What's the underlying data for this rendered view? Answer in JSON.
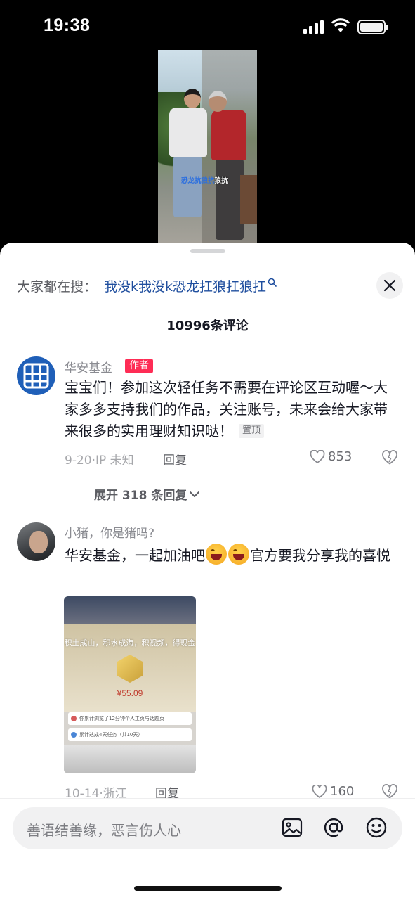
{
  "status_bar": {
    "time": "19:38"
  },
  "video": {
    "caption_blue": "恐龙抗狼抗",
    "caption_white": "狼抗"
  },
  "search": {
    "prefix": "大家都在搜：",
    "query": "我没k我没k恐龙扛狼扛狼扛"
  },
  "comments_header": {
    "count_label": "10996条评论"
  },
  "comments": [
    {
      "username": "华安基金",
      "badge": "作者",
      "text": "宝宝们！参加这次轻任务不需要在评论区互动喔～大家多多支持我们的作品，关注账号，未来会给大家带来很多的实用理财知识哒！",
      "pin_label": "置顶",
      "meta": "9-20·IP 未知",
      "reply_label": "回复",
      "likes": "853",
      "expand_label": "展开 318 条回复"
    },
    {
      "username": "小猪，你是猪吗?",
      "text_before_emoji": "华安基金，一起加油吧",
      "text_after_emoji": "官方要我分享我的喜悦",
      "image": {
        "slogan": "积土成山，积水成海，积视频，得现金",
        "amount": "¥55.09",
        "row1": "你累计浏览了12分钟个人主页与话题页",
        "row2": "累计达成4天任务（共10天）"
      },
      "meta": "10-14·浙江",
      "reply_label": "回复",
      "likes": "160"
    }
  ],
  "input_bar": {
    "placeholder": "善语结善缘，恶言伤人心"
  },
  "colors": {
    "author_badge": "#fe2c55",
    "search_query": "#1f4e9e",
    "avatar_brand": "#1f5fb8"
  }
}
